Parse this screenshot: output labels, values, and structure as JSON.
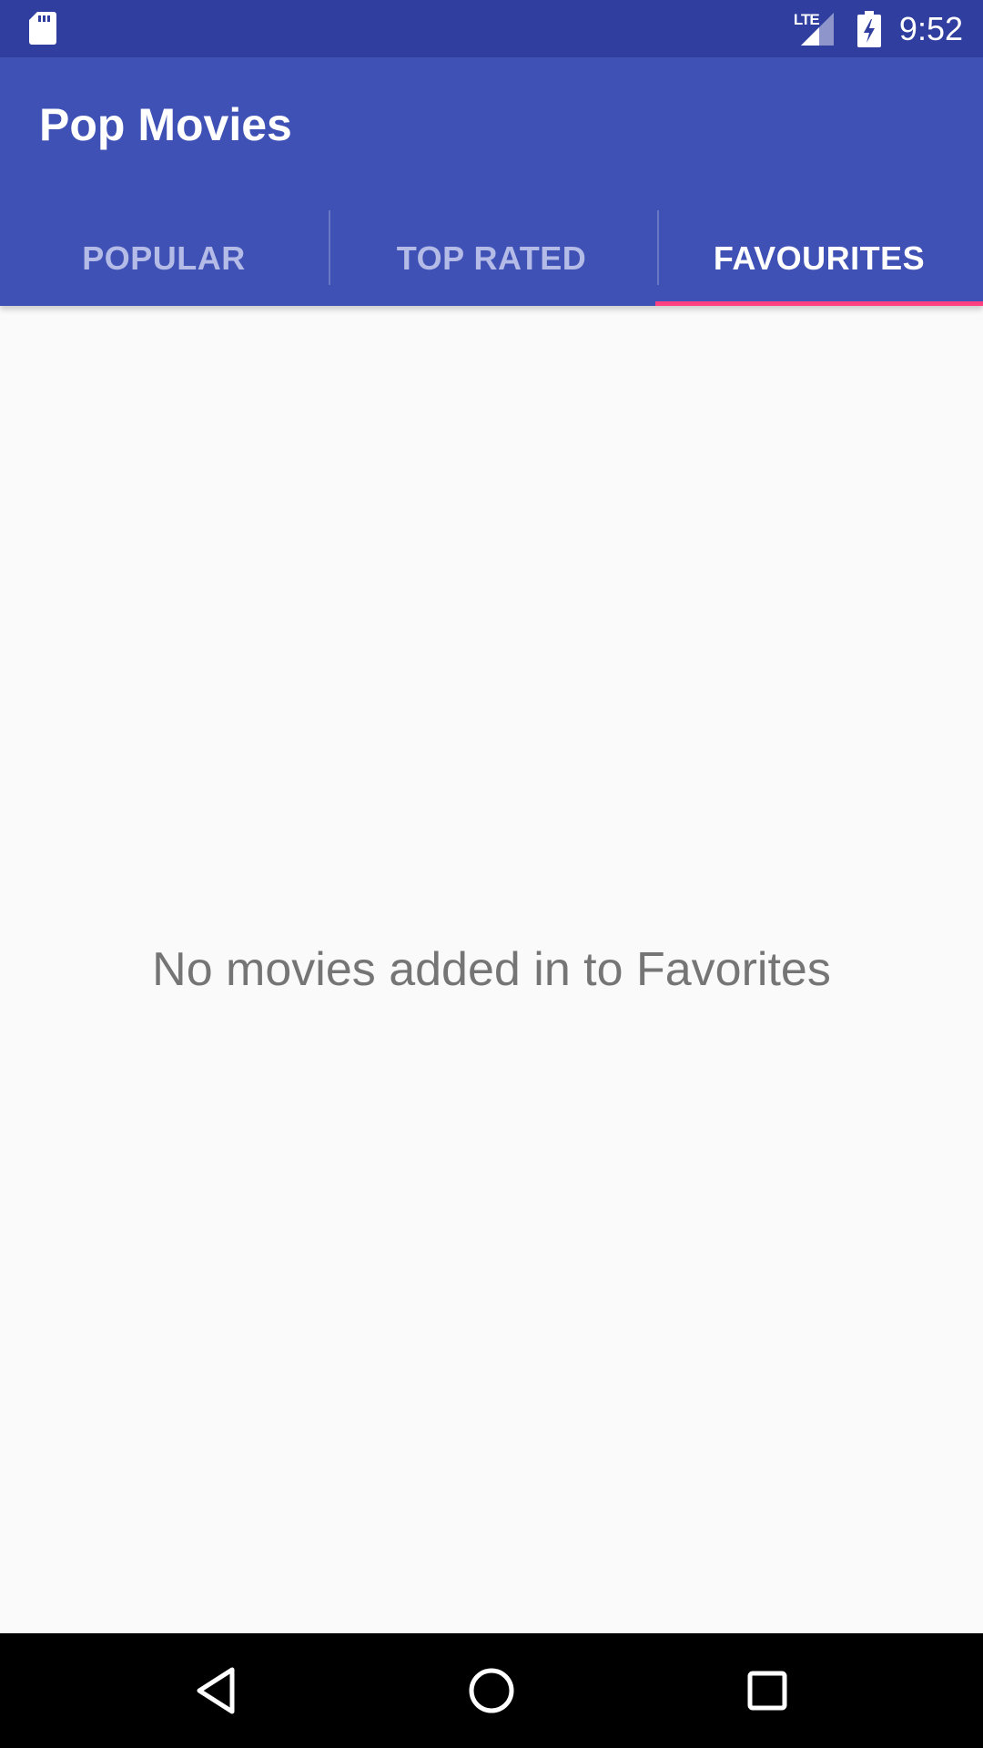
{
  "status_bar": {
    "time": "9:52",
    "network_label": "LTE",
    "icons": [
      "sd-card-icon",
      "lte-signal-icon",
      "battery-charging-icon"
    ]
  },
  "app_bar": {
    "title": "Pop Movies",
    "background_color": "#3f51b5",
    "status_bar_color": "#303f9f",
    "tabs": [
      {
        "label": "POPULAR",
        "selected": false
      },
      {
        "label": "TOP RATED",
        "selected": false
      },
      {
        "label": "FAVOURITES",
        "selected": true
      }
    ],
    "indicator_color": "#ff4081"
  },
  "content": {
    "empty_message": "No movies added in to Favorites"
  },
  "nav_bar": {
    "icons": [
      "back-icon",
      "home-icon",
      "recents-icon"
    ]
  }
}
